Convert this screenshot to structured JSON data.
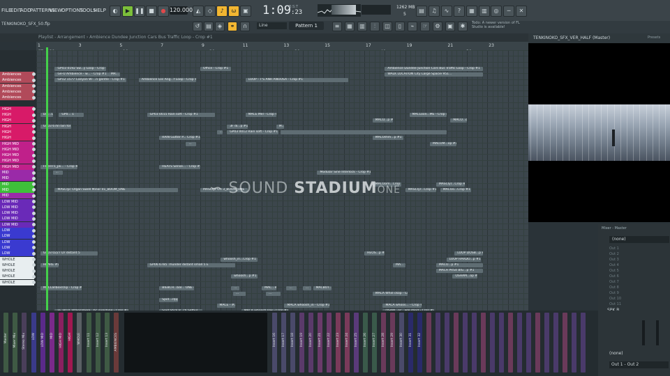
{
  "menu": [
    "FILE",
    "EDIT",
    "ADD",
    "PATTERNS",
    "VIEW",
    "OPTIONS",
    "TOOLS",
    "HELP"
  ],
  "transport": {
    "tempo": "120.000",
    "time": "1:09",
    "time_sub": ":23",
    "bst": "B:S:T"
  },
  "system": {
    "memory": "1262 MB",
    "cpu": "5"
  },
  "project_name": "TENKINOKO_SFX_50.flp",
  "snap": "Line",
  "pattern": "Pattern 1",
  "hint": "Todo: A newer version of FL Studio is available!",
  "playlist_title": "Playlist - Arrangement › Ambience Dundee Junction Cars Bus Traffic Loop - Crop #1",
  "ruler": {
    "numbers": [
      "1",
      "3",
      "5",
      "7",
      "9",
      "11",
      "13",
      "15",
      "17",
      "19",
      "21",
      "23"
    ],
    "labels": [
      "CT=120",
      "10s",
      "20s",
      "30s",
      "40s",
      "50s"
    ]
  },
  "tracks": [
    {
      "label": "Ambiences",
      "color": "#b14a5a"
    },
    {
      "label": "Ambiences",
      "color": "#b14a5a"
    },
    {
      "label": "Ambiences",
      "color": "#b14a5a"
    },
    {
      "label": "Ambiences",
      "color": "#b14a5a"
    },
    {
      "label": "Ambiences",
      "color": "#b14a5a"
    },
    {
      "label": "HIGH",
      "color": "#d81a68"
    },
    {
      "label": "HIGH",
      "color": "#d81a68"
    },
    {
      "label": "HIGH",
      "color": "#d81a68"
    },
    {
      "label": "HIGH",
      "color": "#d81a68"
    },
    {
      "label": "HIGH",
      "color": "#d81a68"
    },
    {
      "label": "HIGH",
      "color": "#d81a68"
    },
    {
      "label": "HIGH MID",
      "color": "#c0208a"
    },
    {
      "label": "HIGH MID",
      "color": "#c0208a"
    },
    {
      "label": "HIGH MID",
      "color": "#c0208a"
    },
    {
      "label": "HIGH MID",
      "color": "#c0208a"
    },
    {
      "label": "HIGH MID",
      "color": "#c0208a"
    },
    {
      "label": "MID",
      "color": "#9a2aa8"
    },
    {
      "label": "MID",
      "color": "#9a2aa8"
    },
    {
      "label": "MID",
      "color": "#3fbf3a"
    },
    {
      "label": "MID",
      "color": "#3fbf3a"
    },
    {
      "label": "MID",
      "color": "#9a2aa8"
    },
    {
      "label": "LOW MID",
      "color": "#6a2ab8"
    },
    {
      "label": "LOW MID",
      "color": "#6a2ab8"
    },
    {
      "label": "LOW MID",
      "color": "#6a2ab8"
    },
    {
      "label": "LOW MID",
      "color": "#6a2ab8"
    },
    {
      "label": "LOW MID",
      "color": "#6a2ab8"
    },
    {
      "label": "LOW",
      "color": "#3a3ad0"
    },
    {
      "label": "LOW",
      "color": "#3a3ad0"
    },
    {
      "label": "LOW",
      "color": "#3a3ad0"
    },
    {
      "label": "LOW",
      "color": "#3a3ad0"
    },
    {
      "label": "LOW",
      "color": "#3a3ad0"
    },
    {
      "label": "WHOLE",
      "color": "#e8eef0"
    },
    {
      "label": "WHOLE",
      "color": "#e8eef0"
    },
    {
      "label": "WHOLE",
      "color": "#e8eef0"
    },
    {
      "label": "WHOLE",
      "color": "#e8eef0"
    },
    {
      "label": "WHOLE",
      "color": "#e8eef0"
    }
  ],
  "clips": [
    {
      "row": 2,
      "start": 1.9,
      "len": 2.5,
      "label": "GPO3 0192 Sw...y Loop - Crop #1"
    },
    {
      "row": 2,
      "start": 9.0,
      "len": 1.5,
      "label": "Office - Crop #1"
    },
    {
      "row": 2,
      "start": 18.0,
      "len": 4.8,
      "label": "Ambience Dundee Junction Cars Bus Traffic Loop - Crop #1"
    },
    {
      "row": 3,
      "start": 1.9,
      "len": 2.6,
      "label": "Ge-U Ambience - w... - Crop #1"
    },
    {
      "row": 3,
      "start": 4.5,
      "len": 0.6,
      "label": "MR..."
    },
    {
      "row": 3,
      "start": 18.0,
      "len": 4.8,
      "label": "WALK LOCATION City Large Spacie 951..."
    },
    {
      "row": 4,
      "start": 1.9,
      "len": 3.5,
      "label": "GP12 1577 Canyon W-...n gentle - Crop #1"
    },
    {
      "row": 4,
      "start": 6.0,
      "len": 2.8,
      "label": "Ambience Los Ang...f Loop - Crop #1"
    },
    {
      "row": 4,
      "start": 11.2,
      "len": 5.0,
      "label": "LOOP - T'S ANR ANOOSA - Crop #1"
    },
    {
      "row": 10,
      "start": 1.2,
      "len": 0.6,
      "label": "Dis...1.1"
    },
    {
      "row": 10,
      "start": 2.1,
      "len": 1.2,
      "label": "GP0... 1"
    },
    {
      "row": 10,
      "start": 6.4,
      "len": 3.3,
      "label": "GP03 0015 Rain soft - Crop #1"
    },
    {
      "row": 10,
      "start": 11.2,
      "len": 1.5,
      "label": "MACE Mel - Crop #1"
    },
    {
      "row": 10,
      "start": 19.2,
      "len": 1.8,
      "label": "MACLoon...ME - Crop #1"
    },
    {
      "row": 11,
      "start": 17.4,
      "len": 1.0,
      "label": "MACO...p #1"
    },
    {
      "row": 11,
      "start": 21.2,
      "len": 0.8,
      "label": "MACO...op #1"
    },
    {
      "row": 12,
      "start": 1.2,
      "len": 1.5,
      "label": "GP03 678 rain fol"
    },
    {
      "row": 12,
      "start": 10.3,
      "len": 1.0,
      "label": "3F di...p #1"
    },
    {
      "row": 12,
      "start": 12.7,
      "len": 0.4,
      "label": "M..."
    },
    {
      "row": 13,
      "start": 9.8,
      "len": 0.3,
      "label": "..."
    },
    {
      "row": 13,
      "start": 10.3,
      "len": 2.5,
      "label": "GP03 0012 Rain soft - Crop #1"
    },
    {
      "row": 13,
      "start": 12.9,
      "len": 8.1,
      "label": ""
    },
    {
      "row": 14,
      "start": 7.0,
      "len": 2.0,
      "label": "RAIN Gutter P... Crop #1"
    },
    {
      "row": 14,
      "start": 17.4,
      "len": 1.5,
      "label": "MACOthm...p #1"
    },
    {
      "row": 15,
      "start": 8.3,
      "len": 0.5,
      "label": "..."
    },
    {
      "row": 15,
      "start": 20.2,
      "len": 1.3,
      "label": "MACOM...op #1"
    },
    {
      "row": 19,
      "start": 1.2,
      "len": 1.8,
      "label": "FF_HIT5_pk... - Crop #1"
    },
    {
      "row": 19,
      "start": 7.0,
      "len": 2.0,
      "label": "HEATS Sense... - Crop #1"
    },
    {
      "row": 20,
      "start": 1.8,
      "len": 0.5,
      "label": "..."
    },
    {
      "row": 20,
      "start": 14.7,
      "len": 2.6,
      "label": "Modular Sine Interlock - Crop #1"
    },
    {
      "row": 22,
      "start": 17.4,
      "len": 1.4,
      "label": "MACOom...Crop #1"
    },
    {
      "row": 22,
      "start": 20.5,
      "len": 1.4,
      "label": "MASClyr...Crop #1"
    },
    {
      "row": 23,
      "start": 1.9,
      "len": 6.0,
      "label": "MASClyc Organ Swell Minor 01_BOOM_ONE"
    },
    {
      "row": 23,
      "start": 9.0,
      "len": 2.3,
      "label": "MASClyr Ori 3_BOOM_ONE"
    },
    {
      "row": 23,
      "start": 19.0,
      "len": 1.5,
      "label": "MASClyr...Crop #1"
    },
    {
      "row": 23,
      "start": 20.7,
      "len": 1.5,
      "label": "MACOo...Crop #1"
    },
    {
      "row": 34,
      "start": 1.2,
      "len": 2.8,
      "label": "GP03 0227 Dr distant 5"
    },
    {
      "row": 34,
      "start": 17.0,
      "len": 1.0,
      "label": "HEOS...p #1"
    },
    {
      "row": 34,
      "start": 21.4,
      "len": 1.4,
      "label": "LOOP DOSB...p #1"
    },
    {
      "row": 35,
      "start": 10.0,
      "len": 1.8,
      "label": "whoosh_in...Crop #1"
    },
    {
      "row": 35,
      "start": 21.0,
      "len": 1.7,
      "label": "LOOP HARDO...p #1"
    },
    {
      "row": 36,
      "start": 1.2,
      "len": 0.9,
      "label": "HEARE #1"
    },
    {
      "row": 36,
      "start": 6.4,
      "len": 4.3,
      "label": "GP06 6785 Thunder distant small 5 E"
    },
    {
      "row": 36,
      "start": 18.4,
      "len": 0.6,
      "label": "MA..."
    },
    {
      "row": 36,
      "start": 20.5,
      "len": 2.3,
      "label": "MACO...p #1"
    },
    {
      "row": 37,
      "start": 20.5,
      "len": 2.3,
      "label": "MACA PRS4 BIG...p #1"
    },
    {
      "row": 38,
      "start": 10.5,
      "len": 1.3,
      "label": "whoosh...p #1"
    },
    {
      "row": 38,
      "start": 21.3,
      "len": 1.2,
      "label": "OSHAM...op #1"
    },
    {
      "row": 40,
      "start": 1.2,
      "len": 2.0,
      "label": "MACLallboxrclip - Crop #1"
    },
    {
      "row": 40,
      "start": 7.0,
      "len": 1.7,
      "label": "BIEBCH...bal... ONE - Crop #1"
    },
    {
      "row": 40,
      "start": 10.5,
      "len": 0.4,
      "label": "..."
    },
    {
      "row": 40,
      "start": 12.0,
      "len": 0.7,
      "label": "MAC...#1"
    },
    {
      "row": 40,
      "start": 13.2,
      "len": 0.5,
      "label": "..."
    },
    {
      "row": 40,
      "start": 14.0,
      "len": 0.4,
      "label": "..."
    },
    {
      "row": 40,
      "start": 14.5,
      "len": 0.9,
      "label": "MACBOT...#1"
    },
    {
      "row": 41,
      "start": 10.6,
      "len": 0.6,
      "label": "..."
    },
    {
      "row": 41,
      "start": 12.2,
      "len": 0.7,
      "label": "..."
    },
    {
      "row": 41,
      "start": 17.4,
      "len": 1.7,
      "label": "MACA Whie ckop - Crop #1"
    },
    {
      "row": 42,
      "start": 7.0,
      "len": 0.9,
      "label": "Spid...clpp"
    },
    {
      "row": 43,
      "start": 9.8,
      "len": 0.9,
      "label": "MACE - #1"
    },
    {
      "row": 43,
      "start": 13.1,
      "len": 2.2,
      "label": "MACA whoosh_in - Crop #1"
    },
    {
      "row": 43,
      "start": 17.9,
      "len": 1.9,
      "label": "MACA whoos... - Crop #1"
    },
    {
      "row": 44,
      "start": 1.9,
      "len": 3.6,
      "label": "FF_HIT4_atmosphere...bc_sunshine - Crop #1"
    },
    {
      "row": 44,
      "start": 7.0,
      "len": 2.1,
      "label": "Spid Stick P...ch Sefbul"
    },
    {
      "row": 44,
      "start": 11.0,
      "len": 2.3,
      "label": "MACA whoosh low - Crop #1"
    },
    {
      "row": 44,
      "start": 17.9,
      "len": 2.5,
      "label": "OSAM...oc...wle.dand - Crop #1"
    }
  ],
  "watermark": {
    "light": "SOUND",
    "bold": "STADIUM",
    "suffix": "ONE"
  },
  "video": {
    "title": "TENKINOKO_SFX_VER_HALF (Master)",
    "preset": "Presets"
  },
  "mixer_panel": {
    "title": "Mixer - Master",
    "input": "(none)",
    "output": "Out 1 - Out 2",
    "speaker": "SPK B",
    "outs": [
      "Out 1",
      "Out 2",
      "Out 3",
      "Out 4",
      "Out 5",
      "Out 6",
      "Out 7",
      "Out 8",
      "Out 9",
      "Out 10",
      "Out 11"
    ]
  },
  "mixer_strips": [
    "Master",
    "Mixer Mix",
    "Stereo Mix",
    "LOW",
    "LOW MID",
    "MID",
    "HIGH MID",
    "HIGH",
    "WHOLE",
    "Insert 11",
    "Insert 12",
    "Insert 13",
    "AMBIENCES",
    "Insert 16",
    "Insert 17",
    "Insert 18",
    "Insert 19",
    "Insert 20",
    "Insert 21",
    "Insert 22",
    "Insert 23",
    "Insert 24",
    "Insert 25",
    "Insert 26",
    "Insert 27",
    "Insert 28",
    "Insert 29",
    "Insert 30",
    "Insert 31",
    "Insert 32"
  ],
  "colors": {
    "accent": "#f2b632",
    "playhead": "#44d04a",
    "clip": "#5f6d73"
  }
}
